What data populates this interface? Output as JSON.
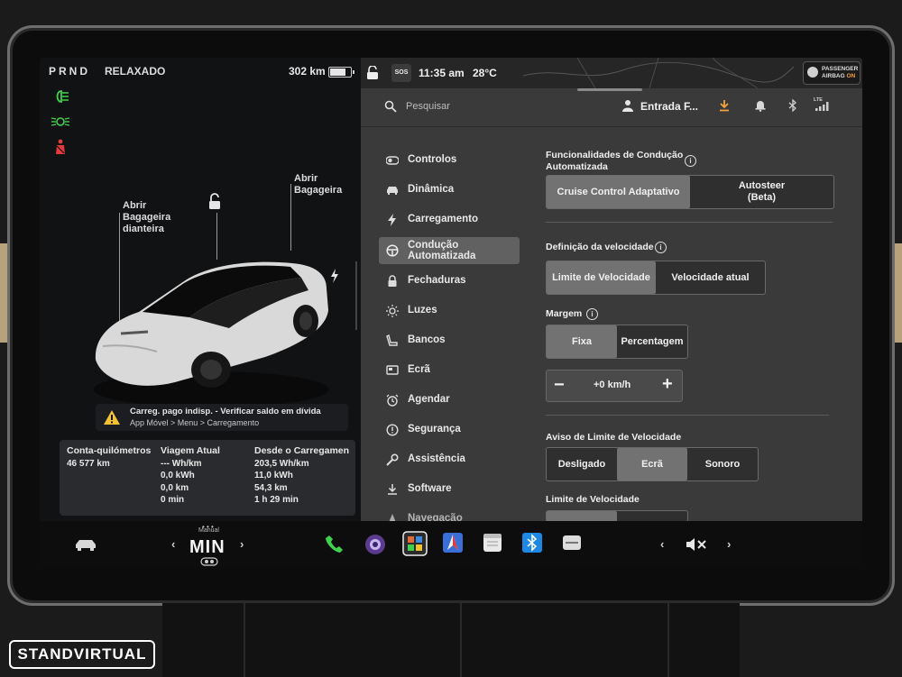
{
  "watermark": "STANDVIRTUAL",
  "car_panel": {
    "gear": "PRND",
    "drive_mode": "RELAXADO",
    "range": "302 km",
    "battery_level": 0.75,
    "rear_trunk_label": "Abrir\nBagageira",
    "front_trunk_label": "Abrir\nBagageira\ndianteira",
    "warning_line1": "Carreg. pago indisp. - Verificar saldo em dívida",
    "warning_line2": "App Móvel > Menu > Carregamento",
    "trip": {
      "odometer": {
        "header": "Conta-quilómetros",
        "value": "46 577 km"
      },
      "current": {
        "header": "Viagem Atual",
        "rows": [
          "--- Wh/km",
          "0,0 kWh",
          "0,0 km",
          "0 min"
        ]
      },
      "since_charge": {
        "header": "Desde o Carregamen",
        "rows": [
          "203,5 Wh/km",
          "11,0 kWh",
          "54,3 km",
          "1 h 29 min"
        ]
      }
    }
  },
  "status_bar": {
    "sos_label": "SOS",
    "time": "11:35 am",
    "temperature": "28°C",
    "airbag_line1": "PASSENGER",
    "airbag_line2": "AIRBAG",
    "airbag_state": "ON"
  },
  "header": {
    "search_placeholder": "Pesquisar",
    "profile_name": "Entrada F...",
    "lte_label": "LTE"
  },
  "menu": {
    "items": [
      {
        "label": "Controlos"
      },
      {
        "label": "Dinâmica"
      },
      {
        "label": "Carregamento"
      },
      {
        "label": "Condução\nAutomatizada"
      },
      {
        "label": "Fechaduras"
      },
      {
        "label": "Luzes"
      },
      {
        "label": "Bancos"
      },
      {
        "label": "Ecrã"
      },
      {
        "label": "Agendar"
      },
      {
        "label": "Segurança"
      },
      {
        "label": "Assistência"
      },
      {
        "label": "Software"
      },
      {
        "label": "Navegação"
      }
    ]
  },
  "settings": {
    "autopilot": {
      "title": "Funcionalidades de Condução\nAutomatizada",
      "options": [
        "Cruise Control Adaptativo",
        "Autosteer\n(Beta)"
      ]
    },
    "speed_definition": {
      "title": "Definição da velocidade",
      "options": [
        "Limite de Velocidade",
        "Velocidade atual"
      ]
    },
    "margin": {
      "title": "Margem",
      "options": [
        "Fixa",
        "Percentagem"
      ],
      "minus": "−",
      "value": "+0 km/h",
      "plus": "+"
    },
    "speed_limit_warning": {
      "title": "Aviso de Limite de Velocidade",
      "options": [
        "Desligado",
        "Ecrã",
        "Sonoro"
      ]
    },
    "speed_limit": {
      "title": "Limite de Velocidade"
    }
  },
  "bottom_bar": {
    "climate_mode": "Manual",
    "fan": "MIN",
    "prev": "‹",
    "next": "›",
    "vol_prev": "‹",
    "vol_next": "›"
  },
  "colors": {
    "accent_green": "#3fd14b",
    "warning_yellow": "#f2c230",
    "airbag_orange": "#f2a33a",
    "selected_segment": "#727272"
  }
}
